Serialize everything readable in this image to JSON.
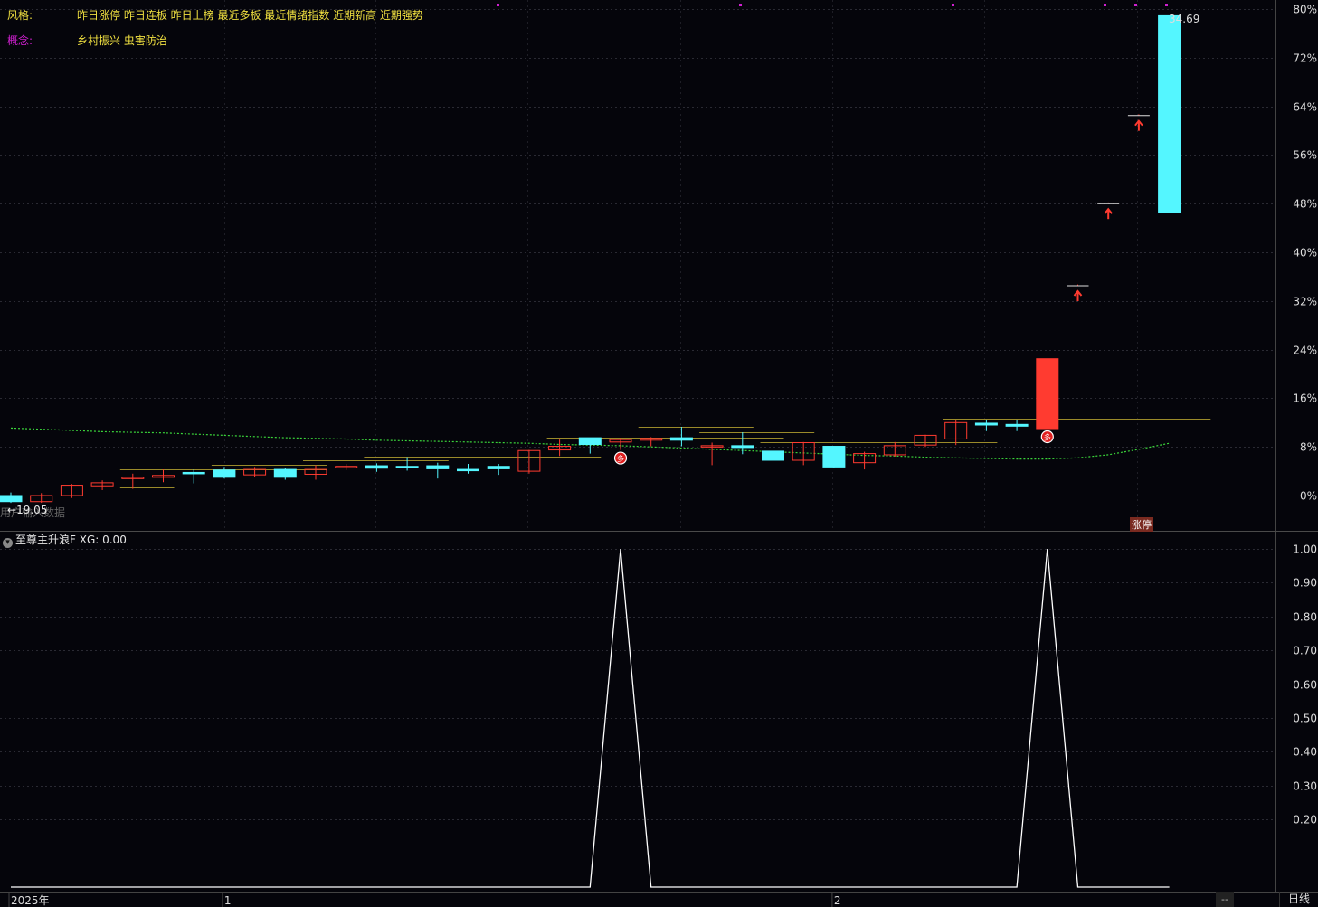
{
  "header": {
    "style_label": "风格:",
    "style_tags": "昨日涨停 昨日连板 昨日上榜 最近多板 最近情绪指数 近期新高 近期强势",
    "concept_label": "概念:",
    "concept_tags": "乡村振兴 虫害防治"
  },
  "annotations": {
    "max_price": "34.69",
    "min_price": "19.05",
    "min_arrow": "←",
    "faded_text": "用户输入数据",
    "limit_badge": "涨停",
    "mark_glyph": "多"
  },
  "indicator": {
    "title": "至尊主升浪F",
    "value_label": "XG: 0.00",
    "toggle_glyph": "▾"
  },
  "footer": {
    "period": "日线",
    "dash": "--",
    "x_labels": [
      {
        "label": "2025年",
        "index": 0
      },
      {
        "label": "1",
        "index": 7
      },
      {
        "label": "2",
        "index": 27
      }
    ]
  },
  "colors": {
    "up": "#ff3b30",
    "down": "#54f6ff",
    "ma": "#3ad43a",
    "ref_line": "#9a8a2a",
    "indicator_line": "#ffffff",
    "magenta": "#d020d0",
    "yellow_text": "#f0e040"
  },
  "chart_data": [
    {
      "type": "candlestick",
      "y_axis": {
        "unit": "%",
        "ticks": [
          0,
          8,
          16,
          24,
          32,
          40,
          48,
          56,
          64,
          72,
          80
        ],
        "ylim": [
          -2,
          81
        ]
      },
      "candles": [
        {
          "o": 0.0,
          "c": -1.0,
          "h": 0.5,
          "l": -1.2
        },
        {
          "o": -1.0,
          "c": 0.0,
          "h": 0.4,
          "l": -1.2
        },
        {
          "o": 0.0,
          "c": 1.7,
          "h": 1.9,
          "l": -0.4
        },
        {
          "o": 1.6,
          "c": 2.1,
          "h": 2.5,
          "l": 0.9
        },
        {
          "o": 2.8,
          "c": 3.0,
          "h": 3.6,
          "l": 1.1
        },
        {
          "o": 3.0,
          "c": 3.3,
          "h": 4.3,
          "l": 2.2
        },
        {
          "o": 3.8,
          "c": 3.7,
          "h": 4.3,
          "l": 2.0
        },
        {
          "o": 4.2,
          "c": 3.0,
          "h": 4.7,
          "l": 2.8
        },
        {
          "o": 3.4,
          "c": 4.3,
          "h": 4.7,
          "l": 3.0
        },
        {
          "o": 4.3,
          "c": 3.0,
          "h": 4.5,
          "l": 2.6
        },
        {
          "o": 3.5,
          "c": 4.3,
          "h": 5.0,
          "l": 2.6
        },
        {
          "o": 4.6,
          "c": 4.8,
          "h": 5.2,
          "l": 4.2
        },
        {
          "o": 4.9,
          "c": 4.5,
          "h": 5.3,
          "l": 3.9
        },
        {
          "o": 4.8,
          "c": 4.7,
          "h": 6.3,
          "l": 4.1
        },
        {
          "o": 4.9,
          "c": 4.4,
          "h": 5.4,
          "l": 2.8
        },
        {
          "o": 4.3,
          "c": 4.1,
          "h": 5.2,
          "l": 3.6
        },
        {
          "o": 4.8,
          "c": 4.4,
          "h": 5.2,
          "l": 3.4
        },
        {
          "o": 4.0,
          "c": 7.4,
          "h": 7.5,
          "l": 3.6
        },
        {
          "o": 7.5,
          "c": 8.1,
          "h": 9.2,
          "l": 6.5
        },
        {
          "o": 9.5,
          "c": 8.4,
          "h": 9.5,
          "l": 6.9
        },
        {
          "o": 8.8,
          "c": 9.2,
          "h": 9.5,
          "l": 7.5
        },
        {
          "o": 9.1,
          "c": 9.4,
          "h": 9.6,
          "l": 8.1
        },
        {
          "o": 9.5,
          "c": 9.1,
          "h": 11.3,
          "l": 8.1
        },
        {
          "o": 8.1,
          "c": 8.2,
          "h": 8.7,
          "l": 5.0
        },
        {
          "o": 8.2,
          "c": 7.9,
          "h": 10.4,
          "l": 6.8
        },
        {
          "o": 7.3,
          "c": 5.8,
          "h": 7.3,
          "l": 5.3
        },
        {
          "o": 5.8,
          "c": 8.7,
          "h": 8.8,
          "l": 5.0
        },
        {
          "o": 8.1,
          "c": 4.7,
          "h": 8.1,
          "l": 4.6
        },
        {
          "o": 5.4,
          "c": 6.9,
          "h": 7.2,
          "l": 4.3
        },
        {
          "o": 6.7,
          "c": 8.2,
          "h": 8.8,
          "l": 6.4
        },
        {
          "o": 8.3,
          "c": 9.9,
          "h": 10.0,
          "l": 8.0
        },
        {
          "o": 9.3,
          "c": 12.0,
          "h": 12.4,
          "l": 8.3
        },
        {
          "o": 11.9,
          "c": 11.6,
          "h": 12.5,
          "l": 10.6
        },
        {
          "o": 11.7,
          "c": 11.4,
          "h": 12.5,
          "l": 10.6
        },
        {
          "o": 11.0,
          "c": 22.5,
          "h": 22.5,
          "l": 11.0
        },
        {
          "o": 34.5,
          "c": 34.5,
          "h": 34.7,
          "l": 34.5
        },
        {
          "o": 48.0,
          "c": 48.0,
          "h": 48.2,
          "l": 48.0
        },
        {
          "o": 62.5,
          "c": 62.5,
          "h": 62.7,
          "l": 62.5
        },
        {
          "o": 78.9,
          "c": 46.6,
          "h": 78.9,
          "l": 46.6
        }
      ],
      "ma_series": [
        11.1,
        10.9,
        10.7,
        10.5,
        10.4,
        10.3,
        10.1,
        9.9,
        9.7,
        9.5,
        9.4,
        9.3,
        9.1,
        9.0,
        8.9,
        8.8,
        8.7,
        8.6,
        8.4,
        8.3,
        8.2,
        8.0,
        7.8,
        7.6,
        7.4,
        7.2,
        7.0,
        6.8,
        6.6,
        6.5,
        6.3,
        6.2,
        6.1,
        6.0,
        6.0,
        6.2,
        6.7,
        7.6,
        8.6
      ],
      "ref_segments": [
        {
          "start": 4,
          "end": 5,
          "y": 1.4
        },
        {
          "start": 4,
          "end": 10,
          "y": 4.3
        },
        {
          "start": 7,
          "end": 10,
          "y": 5.0
        },
        {
          "start": 10,
          "end": 14,
          "y": 5.8
        },
        {
          "start": 12,
          "end": 19,
          "y": 6.4
        },
        {
          "start": 18,
          "end": 25,
          "y": 9.5
        },
        {
          "start": 21,
          "end": 24,
          "y": 11.3
        },
        {
          "start": 23,
          "end": 26,
          "y": 10.4
        },
        {
          "start": 25,
          "end": 32,
          "y": 8.8
        },
        {
          "start": 31,
          "end": 39,
          "y": 12.7
        }
      ],
      "signal_markers": [
        {
          "index": 20
        },
        {
          "index": 34
        }
      ],
      "limit_up_arrows": [
        {
          "index": 35
        },
        {
          "index": 36
        },
        {
          "index": 37
        }
      ]
    },
    {
      "type": "line",
      "name": "XG",
      "y_axis": {
        "ticks": [
          0.2,
          0.3,
          0.4,
          0.5,
          0.6,
          0.7,
          0.8,
          0.9,
          1.0
        ],
        "ylim": [
          0,
          1
        ]
      },
      "values": [
        0,
        0,
        0,
        0,
        0,
        0,
        0,
        0,
        0,
        0,
        0,
        0,
        0,
        0,
        0,
        0,
        0,
        0,
        0,
        0,
        1,
        0,
        0,
        0,
        0,
        0,
        0,
        0,
        0,
        0,
        0,
        0,
        0,
        0,
        1,
        0,
        0,
        0,
        0
      ]
    }
  ]
}
